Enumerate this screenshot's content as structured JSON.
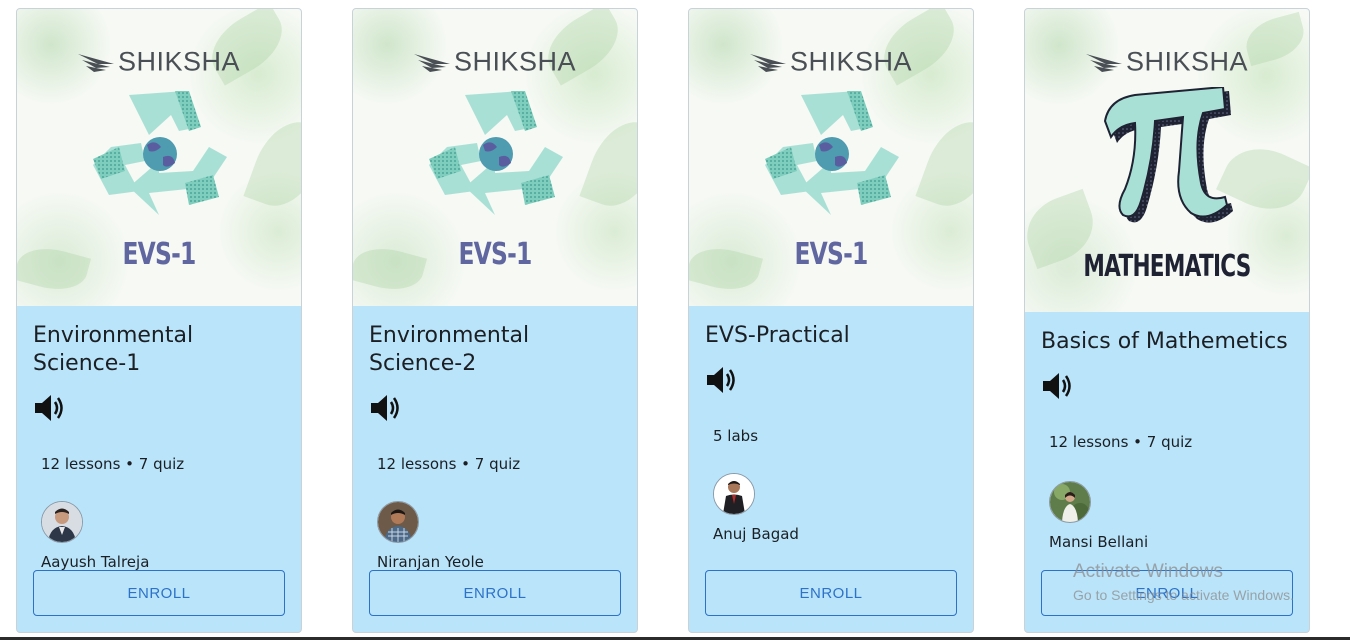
{
  "brand": {
    "name": "SHIKSHA"
  },
  "enroll_label": "ENROLL",
  "courses": [
    {
      "thumbnail_label": "EVS-1",
      "title_line1": "Environmental",
      "title_line2": "Science-1",
      "meta": "12 lessons • 7 quiz",
      "instructor": "Aayush Talreja"
    },
    {
      "thumbnail_label": "EVS-1",
      "title_line1": "Environmental",
      "title_line2": "Science-2",
      "meta": "12 lessons • 7 quiz",
      "instructor": "Niranjan Yeole"
    },
    {
      "thumbnail_label": "EVS-1",
      "title_line1": "EVS-Practical",
      "title_line2": "",
      "meta": "5 labs",
      "instructor": "Anuj Bagad"
    },
    {
      "thumbnail_label": "MATHEMATICS",
      "title_line1": "Basics of Mathemetics",
      "title_line2": "",
      "meta": "12 lessons • 7 quiz",
      "instructor": "Mansi Bellani"
    }
  ],
  "watermark": {
    "line1": "Activate Windows",
    "line2": "Go to Settings to activate Windows."
  },
  "colors": {
    "card_body": "#bae4fa",
    "accent": "#2d72c9",
    "evs_label": "#6067a0",
    "recycle": "#a9e0d6"
  }
}
